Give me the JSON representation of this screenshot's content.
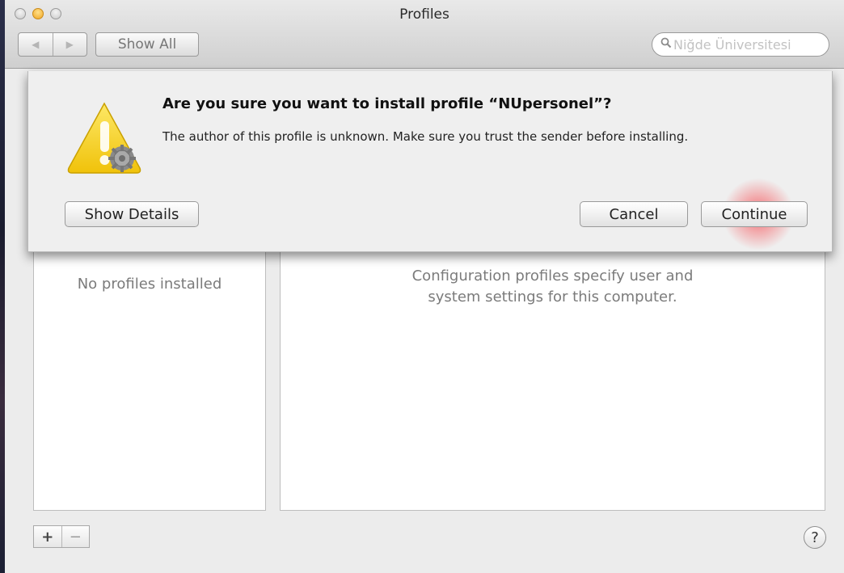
{
  "window": {
    "title": "Profiles",
    "show_all_label": "Show All",
    "back_icon": "◀",
    "forward_icon": "▶"
  },
  "search": {
    "icon": "search-icon",
    "value": "Niğde Üniversitesi"
  },
  "sheet": {
    "title": "Are you sure you want to install profile “NUpersonel”?",
    "message": "The author of this profile is unknown. Make sure you trust the sender before installing.",
    "show_details_label": "Show Details",
    "cancel_label": "Cancel",
    "continue_label": "Continue"
  },
  "profiles_list": {
    "empty_text": "No profiles installed"
  },
  "details": {
    "line1": "Configuration profiles specify user and",
    "line2": "system settings for this computer."
  },
  "bottom_bar": {
    "add_label": "+",
    "remove_label": "−",
    "help_label": "?"
  },
  "colors": {
    "warning_yellow": "#f6d21a",
    "click_highlight": "#f03c46"
  }
}
